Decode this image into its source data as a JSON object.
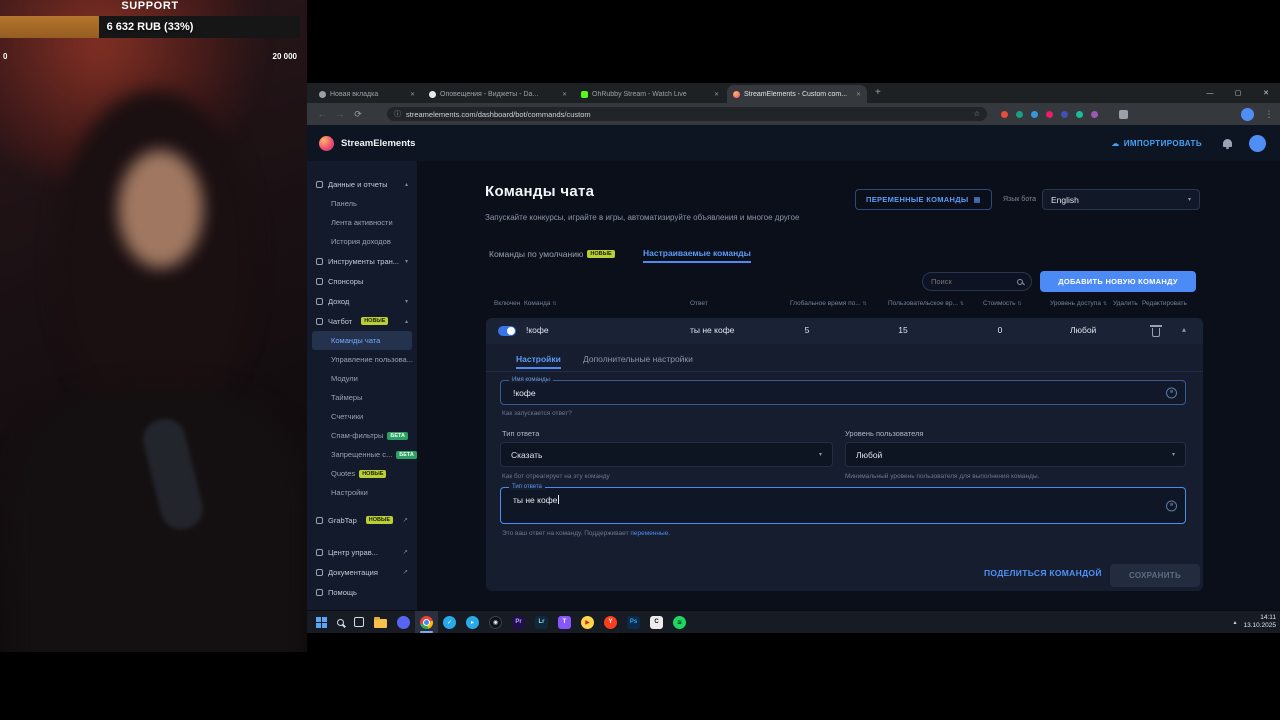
{
  "icons": {
    "chevron_down": "▾",
    "chevron_up": "▴",
    "sort": "⇅",
    "external": "↗",
    "back": "←",
    "forward": "→",
    "reload": "⟳",
    "star": "☆",
    "menu": "⋮",
    "close": "✕",
    "minimize": "—",
    "maximize": "▢",
    "new_tab": "+",
    "site_info": "ⓘ",
    "variables": "▦",
    "insert": "≡",
    "import": "☁",
    "help": "?"
  },
  "goal_widget": {
    "title": "SUPPORT",
    "progress_label": "6 632 RUB (33%)",
    "min_label": "0",
    "max_label": "20 000",
    "fill_style": "width:33%"
  },
  "browser": {
    "tabs": [
      {
        "title": "Новая вкладка"
      },
      {
        "title": "Оповещения - Виджеты - Da..."
      },
      {
        "title": "OhRubby Stream - Watch Live"
      },
      {
        "title": "StreamElements - Custom com..."
      }
    ],
    "url": "streamelements.com/dashboard/bot/commands/custom"
  },
  "app": {
    "topbar": {
      "brand": "StreamElements",
      "import_label": "ИМПОРТИРОВАТЬ"
    },
    "sidebar": {
      "data_reports": "Данные и отчеты",
      "panel": "Панель",
      "activity_feed": "Лента активности",
      "revenue_history": "История доходов",
      "stream_tools": "Инструменты тран...",
      "sponsors": "Спонсоры",
      "revenue": "Доход",
      "chatbot": "Чатбот",
      "badge_new": "НОВЫЕ",
      "badge_beta": "БЕТА",
      "chat_commands": "Команды чата",
      "user_management": "Управление пользова...",
      "modules": "Модули",
      "timers": "Таймеры",
      "counters": "Счетчики",
      "spam_filters": "Спам-фильтры",
      "banned_words": "Запрещенные с...",
      "quotes": "Quotes",
      "settings": "Настройки",
      "grabtap": "GrabTap",
      "control_center": "Центр управ...",
      "docs": "Документация",
      "help": "Помощь"
    },
    "main": {
      "title": "Команды чата",
      "subtitle": "Запускайте конкурсы, играйте в игры, автоматизируйте объявления и многое другое",
      "variables_button": "ПЕРЕМЕННЫЕ КОМАНДЫ",
      "bot_language_label": "Язык бота",
      "bot_language_value": "English",
      "tab_default": "Команды по умолчанию",
      "tab_custom": "Настраиваемые команды",
      "search_placeholder": "Поиск",
      "add_button": "ДОБАВИТЬ НОВУЮ КОМАНДУ",
      "col_enabled": "Включен",
      "col_command": "Команда",
      "col_response": "Ответ",
      "col_global_cd": "Глобальное время по...",
      "col_user_cd": "Пользовательское вр...",
      "col_cost": "Стоимость",
      "col_access": "Уровень доступа",
      "col_delete": "Удалить",
      "col_edit": "Редактировать",
      "row": {
        "command": "!кофе",
        "response": "ты не кофе",
        "global_cd": "5",
        "user_cd": "15",
        "cost": "0",
        "access": "Любой"
      },
      "editor": {
        "tab_settings": "Настройки",
        "tab_advanced": "Дополнительные настройки",
        "name_label": "Имя команды",
        "name_value": "!кофе",
        "name_helper": "Как запускается ответ?",
        "reply_type_label": "Тип ответа",
        "reply_type_value": "Сказать",
        "reply_type_helper": "Как бот отреагирует на эту команду",
        "user_level_label": "Уровень пользователя",
        "user_level_value": "Любой",
        "user_level_helper": "Минимальный уровень пользователя для выполнения команды.",
        "response_label": "Тип ответа",
        "response_value": "ты не кофе",
        "response_helper": "Это ваш ответ на команду. Поддерживает",
        "response_helper_link": "переменные.",
        "share_button": "ПОДЕЛИТЬСЯ КОМАНДОЙ",
        "save_button": "СОХРАНИТЬ"
      }
    }
  },
  "taskbar": {
    "time": "14:11",
    "date": "13.10.2025"
  }
}
